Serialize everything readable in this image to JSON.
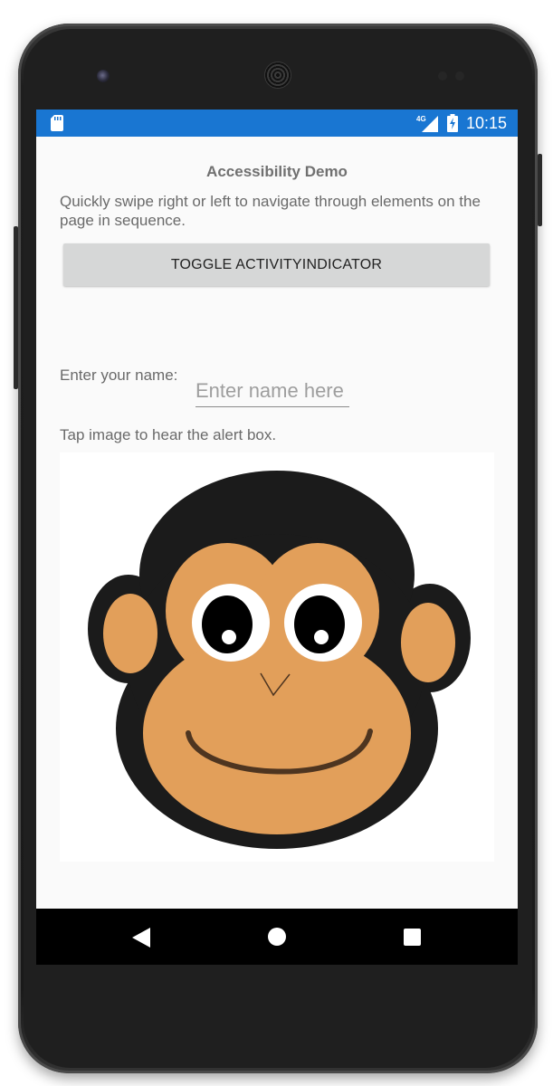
{
  "status_bar": {
    "time": "10:15",
    "network_label": "4G",
    "icons": [
      "sd-card-icon",
      "cell-signal-icon",
      "battery-charging-icon"
    ],
    "color": "#1976d2"
  },
  "page": {
    "title": "Accessibility Demo",
    "instructions": "Quickly swipe right or left to navigate through elements on the page in sequence.",
    "toggle_button_label": "TOGGLE ACTIVITYINDICATOR",
    "name_label": "Enter your name:",
    "name_input": {
      "value": "",
      "placeholder": "Enter name here"
    },
    "image_caption": "Tap image to hear the alert box.",
    "image": {
      "subject": "monkey face cartoon",
      "icon": "monkey-image"
    }
  },
  "nav_bar": {
    "buttons": [
      "back-icon",
      "home-icon",
      "recents-icon"
    ]
  },
  "colors": {
    "monkey_fur": "#1b1b1b",
    "monkey_skin": "#e29f5a",
    "mouth": "#4e3520"
  }
}
